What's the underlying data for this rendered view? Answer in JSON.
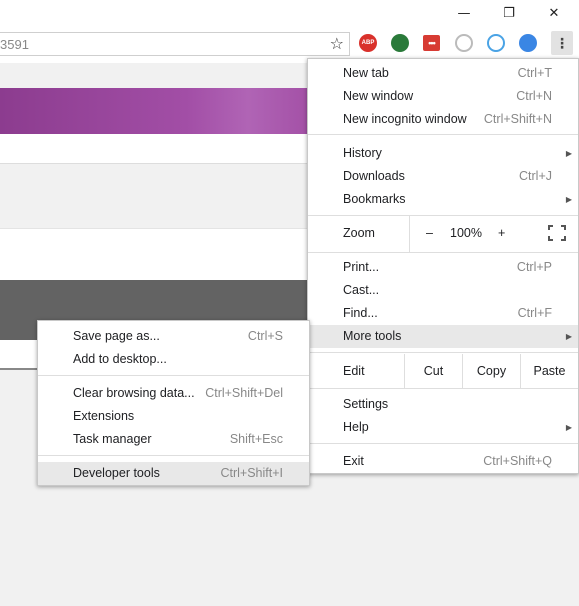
{
  "titlebar": {
    "minimize": "—",
    "maximize": "❐",
    "close": "✕"
  },
  "omnibox": {
    "url_fragment": "3591"
  },
  "extensions": {
    "abp": "ABP",
    "red": "•••"
  },
  "main_menu": {
    "new_tab": "New tab",
    "new_tab_sc": "Ctrl+T",
    "new_window": "New window",
    "new_window_sc": "Ctrl+N",
    "incognito": "New incognito window",
    "incognito_sc": "Ctrl+Shift+N",
    "history": "History",
    "downloads": "Downloads",
    "downloads_sc": "Ctrl+J",
    "bookmarks": "Bookmarks",
    "zoom": "Zoom",
    "zoom_minus": "–",
    "zoom_value": "100%",
    "zoom_plus": "+",
    "print": "Print...",
    "print_sc": "Ctrl+P",
    "cast": "Cast...",
    "find": "Find...",
    "find_sc": "Ctrl+F",
    "more_tools": "More tools",
    "edit": "Edit",
    "cut": "Cut",
    "copy": "Copy",
    "paste": "Paste",
    "settings": "Settings",
    "help": "Help",
    "exit": "Exit",
    "exit_sc": "Ctrl+Shift+Q"
  },
  "sub_menu": {
    "save_page": "Save page as...",
    "save_page_sc": "Ctrl+S",
    "add_desktop": "Add to desktop...",
    "clear_data": "Clear browsing data...",
    "clear_data_sc": "Ctrl+Shift+Del",
    "extensions": "Extensions",
    "task_manager": "Task manager",
    "task_manager_sc": "Shift+Esc",
    "dev_tools": "Developer tools",
    "dev_tools_sc": "Ctrl+Shift+I"
  }
}
